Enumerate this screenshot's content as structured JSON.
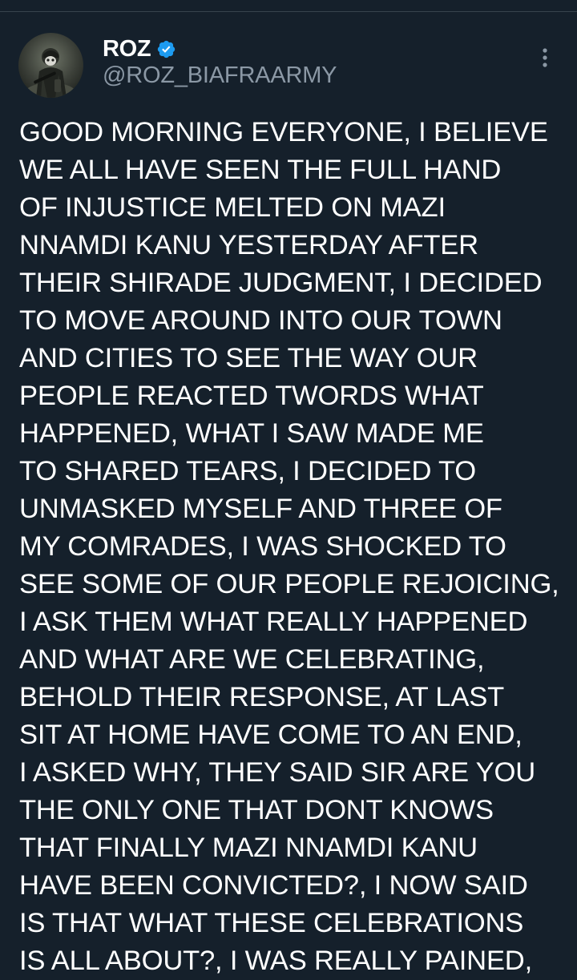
{
  "theme": {
    "background": "#15202b",
    "divider": "#38444d",
    "text_primary": "#ffffff",
    "text_secondary": "#8b98a5",
    "verified_badge": "#1d9bf0"
  },
  "author": {
    "display_name": "ROZ",
    "handle": "@ROZ_BIAFRAARMY",
    "verified": true,
    "avatar_icon": "soldier-avatar"
  },
  "menu": {
    "icon": "more-vertical-icon"
  },
  "tweet": {
    "lines": [
      "GOOD MORNING EVERYONE, I BELIEVE",
      "WE ALL HAVE SEEN THE FULL HAND",
      "OF INJUSTICE MELTED ON MAZI",
      "NNAMDI KANU YESTERDAY AFTER",
      "THEIR SHIRADE JUDGMENT, I DECIDED",
      "TO MOVE AROUND INTO OUR TOWN",
      "AND CITIES TO SEE THE WAY OUR",
      "PEOPLE REACTED TWORDS WHAT",
      "HAPPENED, WHAT I SAW MADE ME",
      "TO SHARED TEARS, I DECIDED TO",
      "UNMASKED MYSELF AND THREE OF",
      "MY COMRADES, I WAS SHOCKED TO",
      "SEE SOME OF OUR PEOPLE REJOICING,",
      "I ASK THEM WHAT REALLY HAPPENED",
      "AND WHAT ARE WE CELEBRATING,",
      "BEHOLD THEIR RESPONSE, AT LAST",
      "SIT AT HOME HAVE COME TO AN END,",
      "I ASKED WHY,  THEY SAID SIR ARE YOU",
      "THE ONLY ONE THAT DONT KNOWS",
      "THAT FINALLY MAZI NNAMDI KANU",
      "HAVE BEEN CONVICTED?, I NOW SAID",
      "IS THAT WHAT THESE CELEBRATIONS",
      "IS ALL ABOUT?, I WAS REALLY PAINED,"
    ]
  }
}
